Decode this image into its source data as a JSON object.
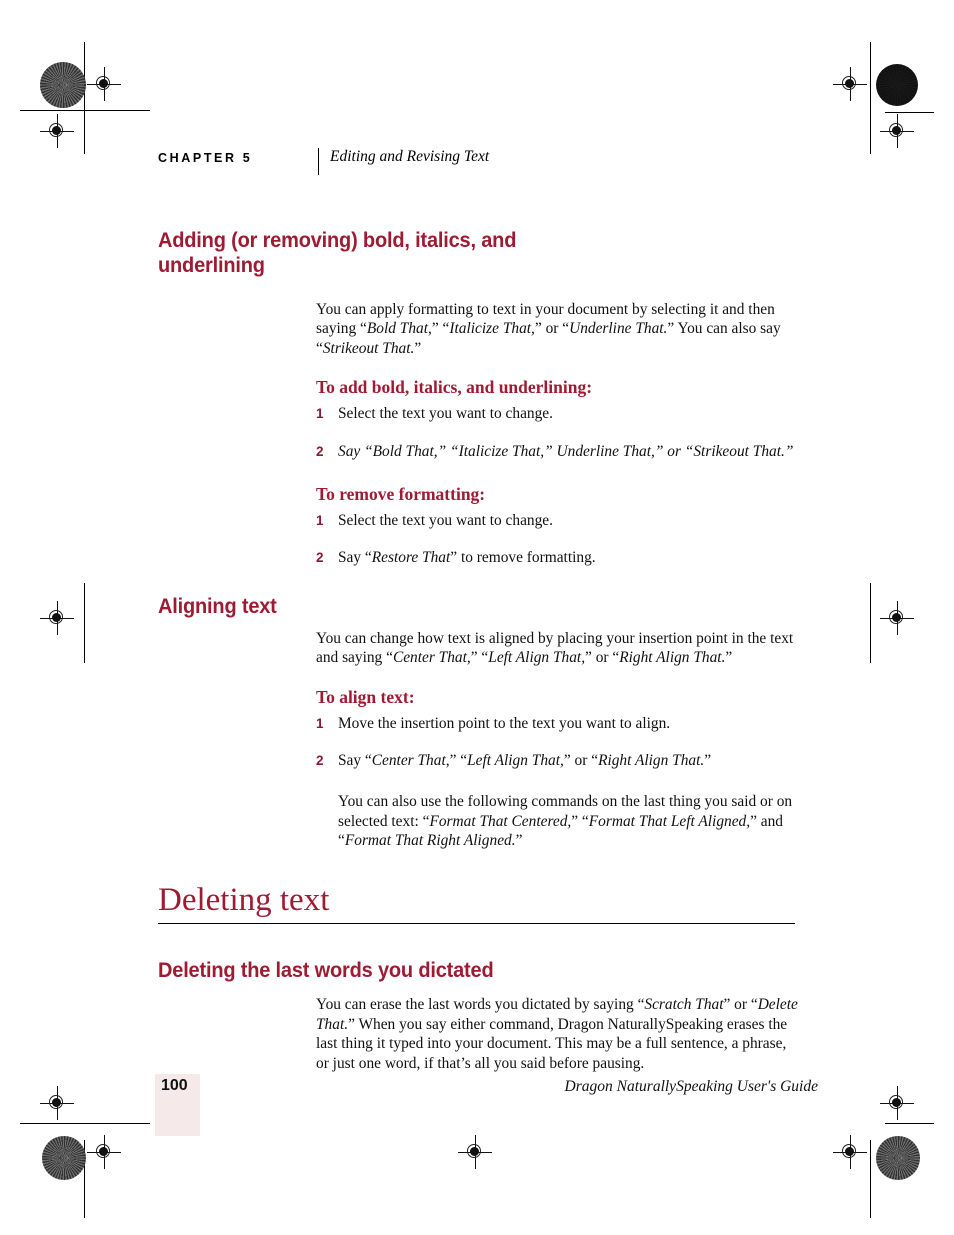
{
  "page": {
    "number": "100",
    "footer_title": "Dragon NaturallySpeaking User's Guide",
    "accent_color": "#9E1B33",
    "page_number_block_color": "#F6E9E9"
  },
  "running_head": {
    "chapter_label": "CHAPTER 5",
    "chapter_title": "Editing and Revising Text"
  },
  "sections": {
    "formatting": {
      "heading_line1": "Adding (or removing) bold, italics, and",
      "heading_line2": "underlining",
      "intro": "You can apply formatting to text in your document by selecting it and then saying “Bold That,” “Italicize That,” or “Underline That.” You can also say “Strikeout That.”",
      "add_subhead": "To add bold, italics, and underlining:",
      "add_step1_num": "1",
      "add_step1": "Select the text you want to change.",
      "add_step2_num": "2",
      "add_step2": "Say “Bold That,” “Italicize That,” Underline That,” or “Strikeout That.”",
      "remove_subhead": "To remove formatting:",
      "remove_step1_num": "1",
      "remove_step1": "Select the text you want to change.",
      "remove_step2_num": "2",
      "remove_step2": "Say “Restore That” to remove formatting."
    },
    "aligning": {
      "heading": "Aligning text",
      "intro": "You can change how text is aligned by placing your insertion point in the text and saying “Center That,” “Left Align That,” or “Right Align That.”",
      "subhead": "To align text:",
      "step1_num": "1",
      "step1": "Move the insertion point to the text you want to align.",
      "step2_num": "2",
      "step2": "Say “Center That,” “Left Align That,” or “Right Align That.”",
      "note": "You can also use the following commands on the last thing you said or on selected text: “Format That Centered,” “Format That Left Aligned,” and “ Format That Right Aligned.”"
    },
    "deleting": {
      "heading": "Deleting text",
      "subheading": "Deleting the last words you dictated",
      "body": "You can erase the last words you dictated by saying “Scratch That” or “Delete That.” When you say either command, Dragon NaturallySpeaking erases the last thing it typed into your document. This may be a full sentence, a phrase, or just one word, if that’s all you said before pausing."
    }
  }
}
